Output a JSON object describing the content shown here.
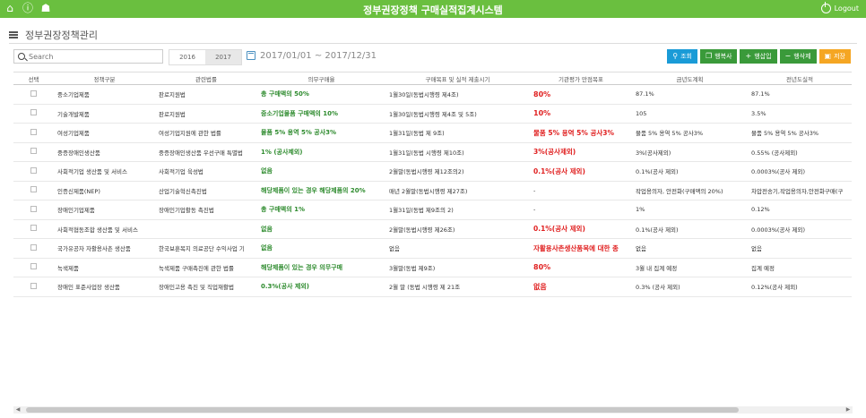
{
  "app": {
    "title": "정부권장정책 구매실적집계시스템",
    "logout_label": "Logout"
  },
  "breadcrumb": {
    "title": "정부권장정책관리"
  },
  "search": {
    "placeholder": "Search"
  },
  "years": [
    "2016",
    "2017"
  ],
  "date_range": "2017/01/01 ~ 2017/12/31",
  "toolbar": {
    "query": "조회",
    "copy_row": "행복사",
    "insert_row": "행삽입",
    "delete_row": "행삭제",
    "save": "저장"
  },
  "table": {
    "headers": [
      "선택",
      "정책구분",
      "관련법률",
      "의무구매율",
      "구매목표 및 실적 제출시기",
      "기관평가 만점목표",
      "금년도계획",
      "전년도실적"
    ],
    "rows": [
      {
        "policy": "중소기업제품",
        "law": "판로지원법",
        "rate": "총 구매액의 50%",
        "submit": "1월30일(동법시행령 제4조)",
        "target": "80%",
        "plan": "87.1%",
        "prev": "87.1%"
      },
      {
        "policy": "기술개발제품",
        "law": "판로지원법",
        "rate": "중소기업물품 구매액의 10%",
        "submit": "1월30일(동법시행령 제4조 및 5조)",
        "target": "10%",
        "plan": "105",
        "prev": "3.5%"
      },
      {
        "policy": "여성기업제품",
        "law": "여성기업지원에 관한 법률",
        "rate": "물품 5% 용역 5% 공사3%",
        "submit": "1월31일(동법 제 9조)",
        "target": "물품 5% 용역 5% 공사3%",
        "plan": "물품 5% 용역 5% 공사3%",
        "prev": "물품 5% 용역 5% 공사3%"
      },
      {
        "policy": "중증장애인생산품",
        "law": "중증장애인생산품 우선구매 특별법",
        "rate": "1% (공사제외)",
        "submit": "1월31일(동법 시행령 제10조)",
        "target": "3%(공사제외)",
        "plan": "3%(공사제외)",
        "prev": "0.55% (공사제외)"
      },
      {
        "policy": "사회적기업 생산품 및 서비스",
        "law": "사회적기업 육성법",
        "rate": "없음",
        "submit": "2월말(동법시행령 제12조의2)",
        "target": "0.1%(공사 제외)",
        "plan": "0.1%(공사 제외)",
        "prev": "0.0003%(공사 제외)"
      },
      {
        "policy": "인증신제품(NEP)",
        "law": "산업기술혁신촉진법",
        "rate": "해당제품이 있는 경우 해당제품의 20%",
        "submit": "매년 2월말(동법시행령 제27조)",
        "target": "-",
        "plan": "작업용의자, 안전화(구매액의 20%)",
        "prev": "차압전송기,작업용의자,안전화구매(구"
      },
      {
        "policy": "장애인기업제품",
        "law": "장애인기업활동 촉진법",
        "rate": "총 구매액의 1%",
        "submit": "1월31일(동법 제9조의 2)",
        "target": "-",
        "plan": "1%",
        "prev": "0.12%"
      },
      {
        "policy": "사회적협동조합 생산품 및 서비스",
        "law": "",
        "rate": "없음",
        "submit": "2월말(동법시행령 제26조)",
        "target": "0.1%(공사 제외)",
        "plan": "0.1%(공사 제외)",
        "prev": "0.0003%(공사 제외)"
      },
      {
        "policy": "국가유공자 자활용사촌 생산품",
        "law": "한국보훈복지 의료공단 수익사업 기",
        "rate": "없음",
        "submit": "없음",
        "target": "자활용사촌생산품목에 대한 종",
        "plan": "없음",
        "prev": "없음"
      },
      {
        "policy": "녹색제품",
        "law": "녹색제품 구매촉진에 관한 법률",
        "rate": "해당제품이 있는 경우 의무구매",
        "submit": "3월말(동법 제9조)",
        "target": "80%",
        "plan": "3월 내 집계 예정",
        "prev": "집계 예정"
      },
      {
        "policy": "장애인 표준사업장 생산품",
        "law": "장애인고용 촉진 및 직업재활법",
        "rate": "0.3%(공사 제외)",
        "submit": "2월 말 (동법 시행령 제 21조",
        "target": "없음",
        "plan": "0.3% (공사 제외)",
        "prev": "0.12%(공사 제외)"
      }
    ]
  },
  "colors": {
    "topbar": "#6abf3f",
    "accent_blue": "#1a9bd7",
    "accent_green": "#3a9a3a",
    "accent_orange": "#f5a623",
    "green_text": "#2e8b2e",
    "red_text": "#e02020"
  }
}
